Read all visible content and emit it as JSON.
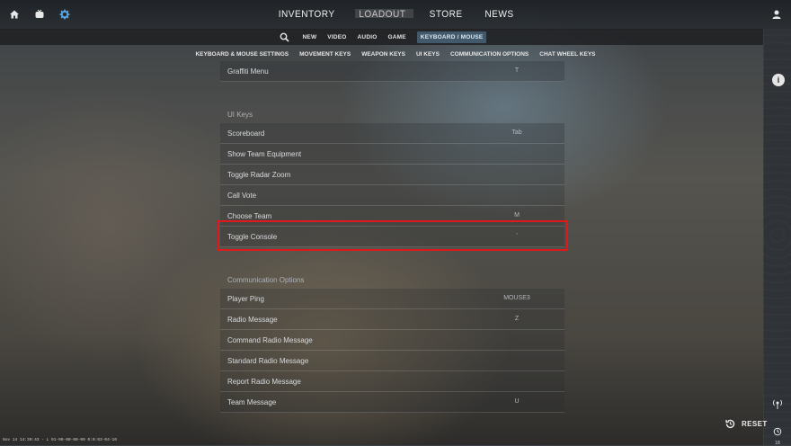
{
  "nav": {
    "items": [
      "INVENTORY",
      "LOADOUT",
      "STORE",
      "NEWS"
    ]
  },
  "subnav": {
    "items": [
      "NEW",
      "VIDEO",
      "AUDIO",
      "GAME",
      "KEYBOARD / MOUSE"
    ],
    "active": "KEYBOARD / MOUSE"
  },
  "categories": [
    "KEYBOARD & MOUSE SETTINGS",
    "MOVEMENT KEYS",
    "WEAPON KEYS",
    "UI KEYS",
    "COMMUNICATION OPTIONS",
    "CHAT WHEEL KEYS"
  ],
  "top_row": {
    "label": "Graffiti Menu",
    "key": "T"
  },
  "sections": [
    {
      "title": "UI Keys",
      "rows": [
        {
          "label": "Scoreboard",
          "key": "Tab"
        },
        {
          "label": "Show Team Equipment",
          "key": ""
        },
        {
          "label": "Toggle Radar Zoom",
          "key": ""
        },
        {
          "label": "Call Vote",
          "key": ""
        },
        {
          "label": "Choose Team",
          "key": "M"
        },
        {
          "label": "Toggle Console",
          "key": "'"
        }
      ]
    },
    {
      "title": "Communication Options",
      "rows": [
        {
          "label": "Player Ping",
          "key": "MOUSE3"
        },
        {
          "label": "Radio Message",
          "key": "Z"
        },
        {
          "label": "Command Radio Message",
          "key": ""
        },
        {
          "label": "Standard Radio Message",
          "key": ""
        },
        {
          "label": "Report Radio Message",
          "key": ""
        },
        {
          "label": "Team Message",
          "key": "U"
        }
      ]
    }
  ],
  "reset_label": "RESET",
  "history_count": "18",
  "status_text": "Nov 14 14:30:43 - L 01-00-00-00-00 0:0:03-04-10"
}
